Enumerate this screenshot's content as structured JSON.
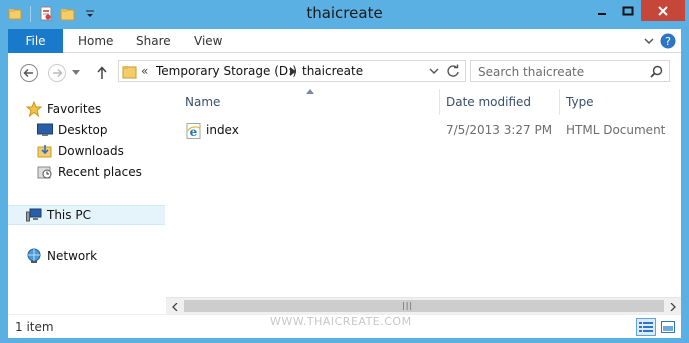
{
  "window": {
    "title": "thaicreate"
  },
  "ribbon": {
    "file_label": "File",
    "tabs": [
      "Home",
      "Share",
      "View"
    ]
  },
  "address": {
    "prefix": "«",
    "segments": [
      "Temporary Storage (D:)",
      "thaicreate"
    ]
  },
  "search": {
    "placeholder": "Search thaicreate"
  },
  "nav": {
    "favorites_label": "Favorites",
    "favorites": [
      "Desktop",
      "Downloads",
      "Recent places"
    ],
    "this_pc": "This PC",
    "network": "Network"
  },
  "columns": [
    "Name",
    "Date modified",
    "Type"
  ],
  "files": [
    {
      "name": "index",
      "date_modified": "7/5/2013 3:27 PM",
      "type": "HTML Document",
      "icon": "ie-html-icon"
    }
  ],
  "status": {
    "count": "1 item",
    "watermark": "WWW.THAICREATE.COM"
  },
  "colors": {
    "titlebar": "#5ab0e3",
    "file_tab": "#1979ca",
    "close": "#c7463a",
    "selection": "#e5f3fb"
  }
}
